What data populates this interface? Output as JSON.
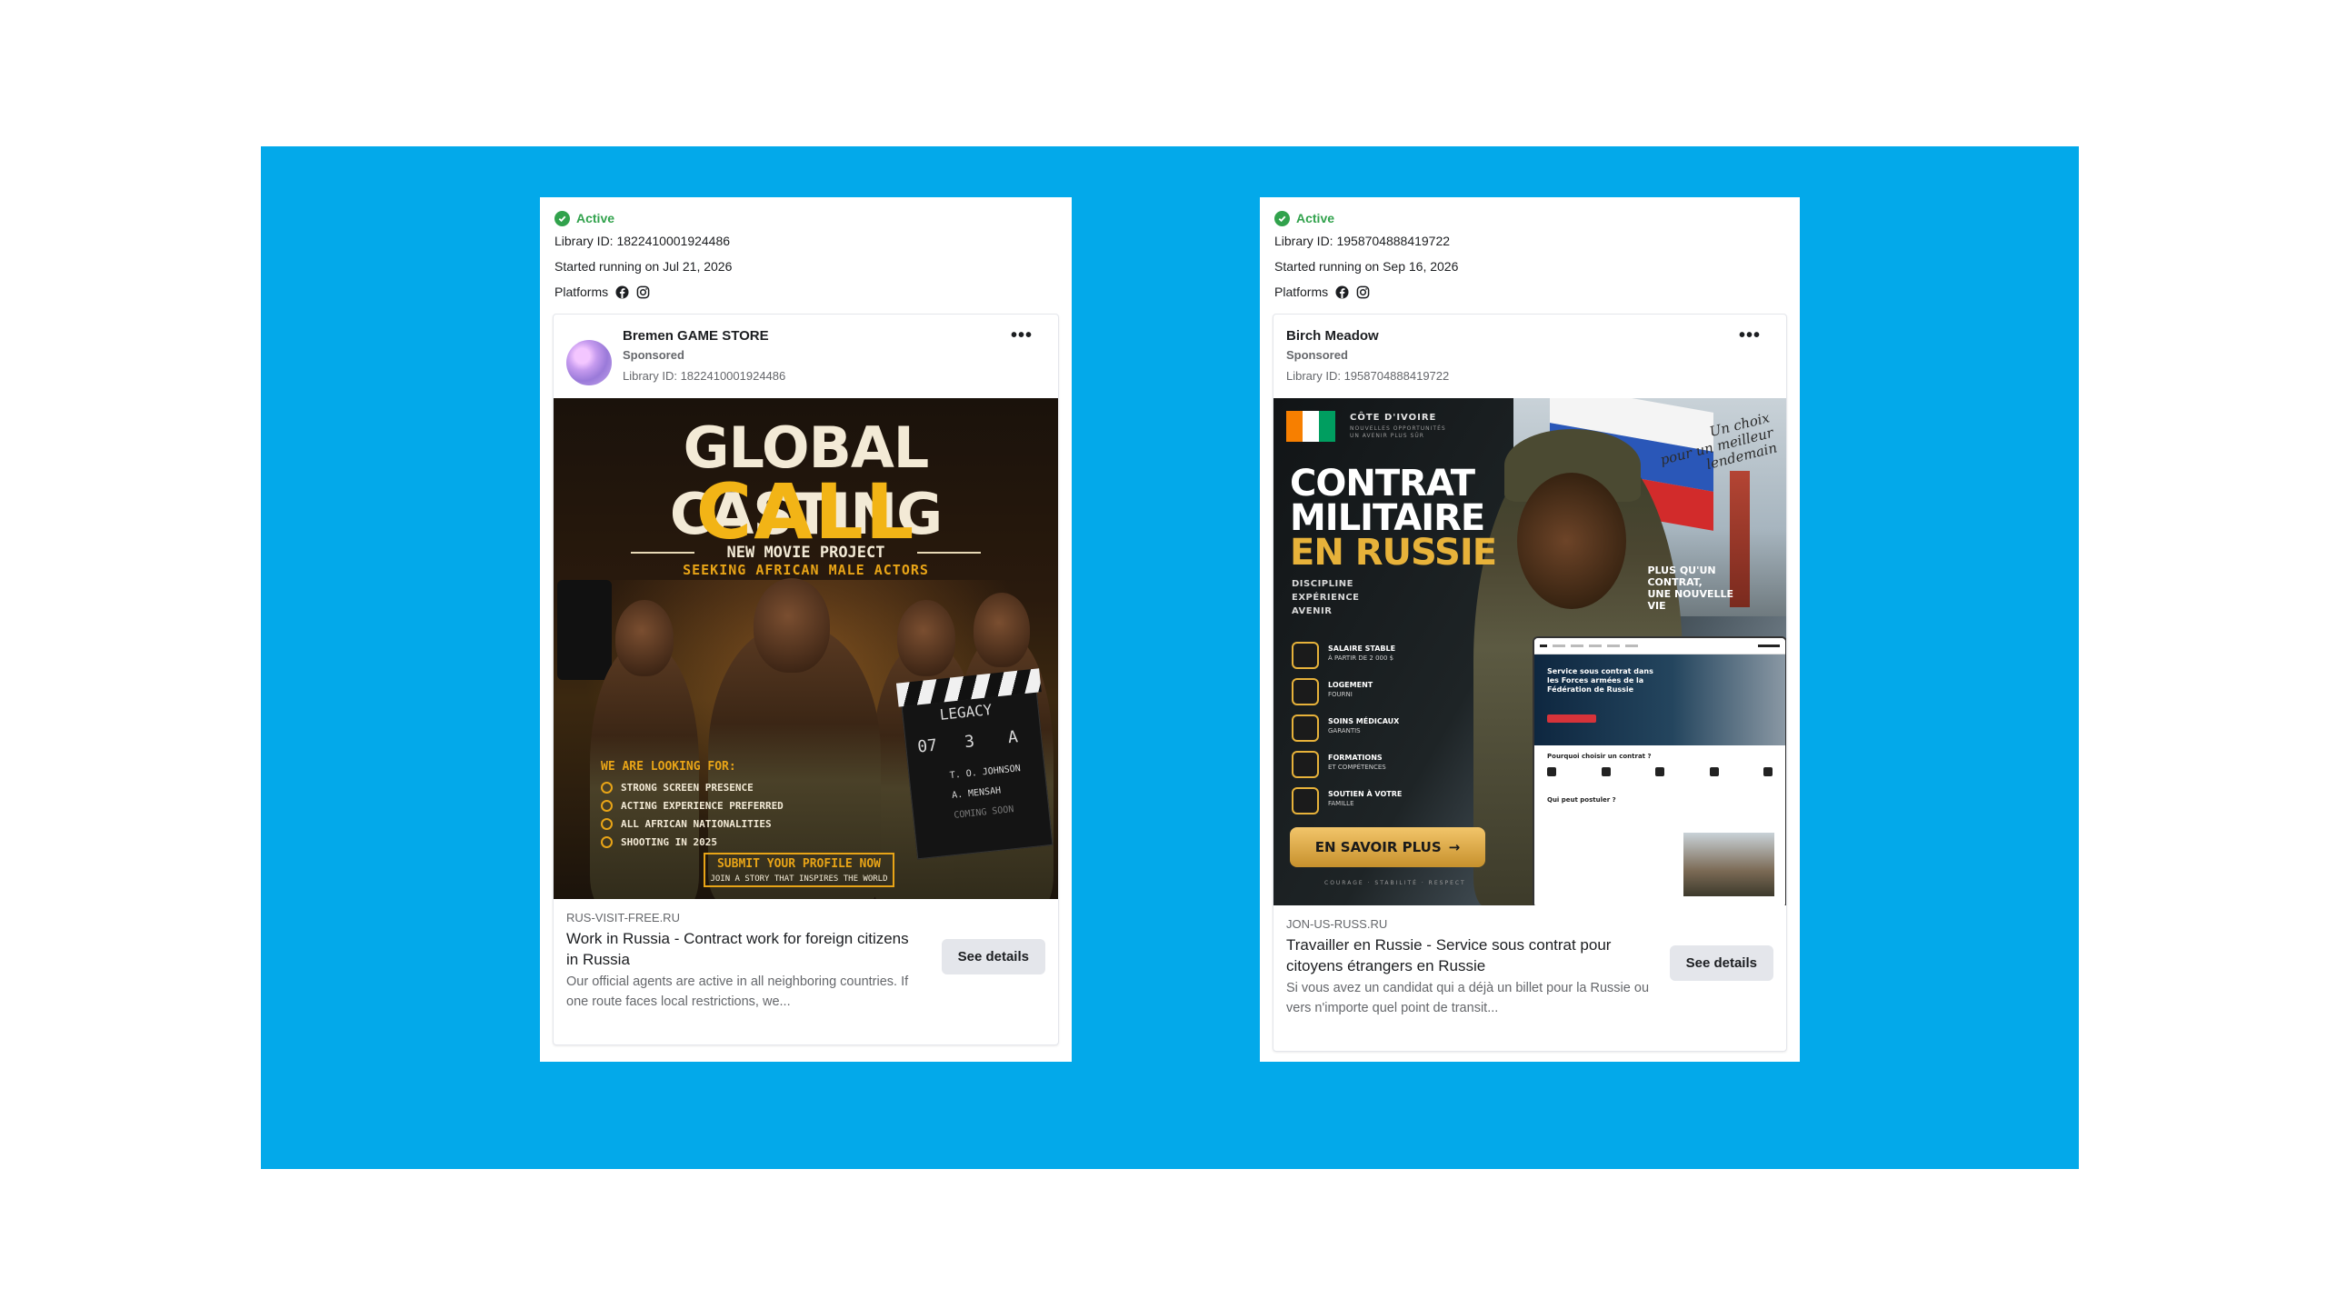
{
  "ads": [
    {
      "status": "Active",
      "library_id_line": "Library ID: 1822410001924486",
      "started_line": "Started running on Jul 21, 2026",
      "platforms_label": "Platforms",
      "platform_icons": [
        "facebook-icon",
        "instagram-icon"
      ],
      "page_name": "Bremen GAME STORE",
      "sponsored": "Sponsored",
      "ad_library_id": "Library ID: 1822410001924486",
      "more": "•••",
      "creative": {
        "title_line1": "GLOBAL CASTING",
        "title_line2": "CALL",
        "subtitle": "NEW MOVIE PROJECT",
        "tagline": "SEEKING AFRICAN MALE ACTORS",
        "looking_for": "WE ARE LOOKING FOR:",
        "bullets": [
          "STRONG SCREEN PRESENCE",
          "ACTING EXPERIENCE PREFERRED",
          "ALL AFRICAN NATIONALITIES",
          "SHOOTING IN 2025"
        ],
        "clapper_title": "LEGACY",
        "clapper_scene": "07",
        "clapper_take": "3",
        "clapper_roll": "A",
        "clapper_director": "T. O. JOHNSON",
        "clapper_camera": "A. MENSAH",
        "clapper_date": "COMING SOON",
        "cta_main": "SUBMIT YOUR PROFILE NOW",
        "cta_sub": "JOIN A STORY THAT INSPIRES THE WORLD"
      },
      "domain": "RUS-VISIT-FREE.RU",
      "headline": "Work in Russia - Contract work for foreign citizens in Russia",
      "description": "Our official agents are active in all neighboring countries. If one route faces local restrictions, we...",
      "cta": "See details"
    },
    {
      "status": "Active",
      "library_id_line": "Library ID: 1958704888419722",
      "started_line": "Started running on Sep 16, 2026",
      "platforms_label": "Platforms",
      "platform_icons": [
        "facebook-icon",
        "instagram-icon"
      ],
      "page_name": "Birch Meadow",
      "sponsored": "Sponsored",
      "ad_library_id": "Library ID: 1958704888419722",
      "more": "•••",
      "creative": {
        "country": "CÔTE D'IVOIRE",
        "country_sub": "NOUVELLES OPPORTUNITÉS UN AVENIR PLUS SÛR",
        "title_line1": "CONTRAT",
        "title_line2": "MILITAIRE",
        "title_line3": "EN RUSSIE",
        "values": [
          "DISCIPLINE",
          "EXPÉRIENCE",
          "AVENIR"
        ],
        "benefits": [
          {
            "title": "SALAIRE STABLE",
            "sub": "À PARTIR DE 2 000 $"
          },
          {
            "title": "LOGEMENT",
            "sub": "FOURNI"
          },
          {
            "title": "SOINS MÉDICAUX",
            "sub": "GARANTIS"
          },
          {
            "title": "FORMATIONS",
            "sub": "ET COMPÉTENCES"
          },
          {
            "title": "SOUTIEN À VOTRE",
            "sub": "FAMILLE"
          }
        ],
        "cta": "EN SAVOIR PLUS",
        "footer": "COURAGE · STABILITÉ · RESPECT",
        "script_line1": "Un choix",
        "script_line2": "pour un meilleur",
        "script_line3": "lendemain",
        "plus_line1": "PLUS QU'UN",
        "plus_line2": "CONTRAT,",
        "plus_line3": "UNE NOUVELLE",
        "plus_line4": "VIE",
        "web_hero": "Service sous contrat dans les Forces armées de la Fédération de Russie",
        "web_question": "Pourquoi choisir un contrat ?",
        "web_who": "Qui peut postuler ?"
      },
      "domain": "JON-US-RUSS.RU",
      "headline": "Travailler en Russie - Service sous contrat pour citoyens étrangers en Russie",
      "description": "Si vous avez un candidat qui a déjà un billet pour la Russie ou vers n'importe quel point de transit...",
      "cta": "See details"
    }
  ],
  "colors": {
    "background": "#03a9ea",
    "active_green": "#31a24c",
    "gold": "#f2b416"
  }
}
